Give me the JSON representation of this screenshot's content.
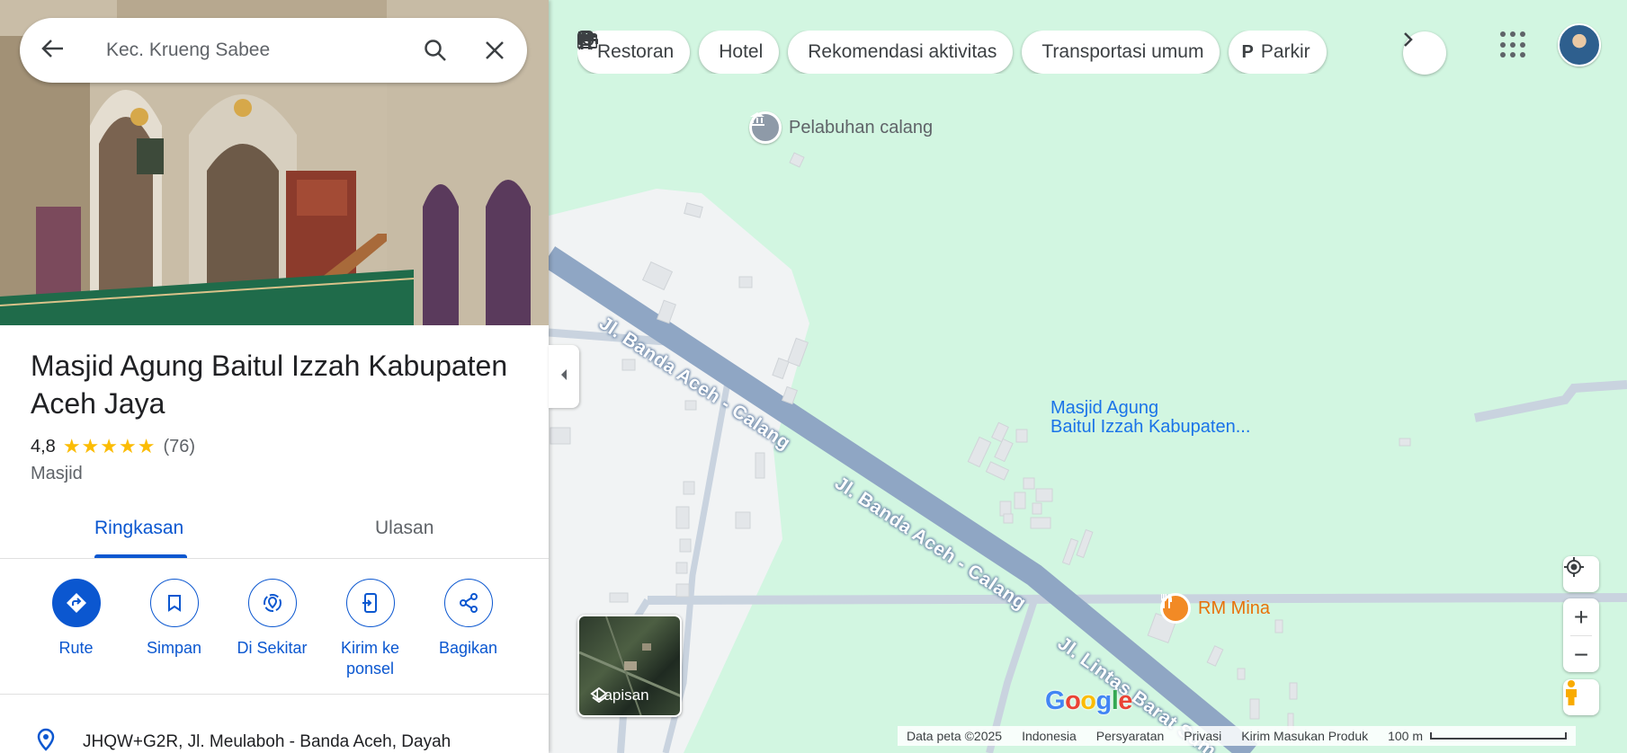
{
  "search": {
    "query": "Kec. Krueng Sabee"
  },
  "place": {
    "title": "Masjid Agung Baitul Izzah Kabupaten Aceh Jaya",
    "rating": "4,8",
    "stars": "★★★★★",
    "review_count": "(76)",
    "category": "Masjid",
    "address": "JHQW+G2R, Jl. Meulaboh - Banda Aceh, Dayah"
  },
  "tabs": [
    {
      "label": "Ringkasan",
      "active": true
    },
    {
      "label": "Ulasan",
      "active": false
    }
  ],
  "actions": [
    {
      "label": "Rute",
      "icon": "directions-icon"
    },
    {
      "label": "Simpan",
      "icon": "bookmark-icon"
    },
    {
      "label": "Di Sekitar",
      "icon": "nearby-icon"
    },
    {
      "label": "Kirim ke ponsel",
      "icon": "send-to-phone-icon"
    },
    {
      "label": "Bagikan",
      "icon": "share-icon"
    }
  ],
  "chips": [
    {
      "label": "Restoran",
      "icon": "restaurant-icon"
    },
    {
      "label": "Hotel",
      "icon": "hotel-icon"
    },
    {
      "label": "Rekomendasi aktivitas",
      "icon": "camera-icon"
    },
    {
      "label": "Transportasi umum",
      "icon": "train-icon"
    },
    {
      "label": "Parkir",
      "icon": "parking-icon"
    }
  ],
  "map": {
    "poi_port": "Pelabuhan calang",
    "poi_restaurant": "RM Mina",
    "marker_label_line1": "Masjid Agung",
    "marker_label_line2": "Baitul Izzah Kabupaten...",
    "road_1": "Jl. Banda Aceh - Calang",
    "road_2": "Jl. Banda Aceh - Calang",
    "road_3": "Jl. Lintas Barat Sum",
    "layers_label": "Lapisan",
    "logo": {
      "g1": "G",
      "o1": "o",
      "o2": "o",
      "g2": "g",
      "l": "l",
      "e": "e"
    }
  },
  "footer": {
    "data": "Data peta ©2025",
    "country": "Indonesia",
    "terms": "Persyaratan",
    "privacy": "Privasi",
    "feedback": "Kirim Masukan Produk",
    "scale": "100 m"
  },
  "colors": {
    "map_bg": "#d2f6e1",
    "road": "#8fa6c4",
    "accent": "#0b57d0",
    "pin_red": "#ea4335",
    "restaurant": "#e8710a"
  }
}
